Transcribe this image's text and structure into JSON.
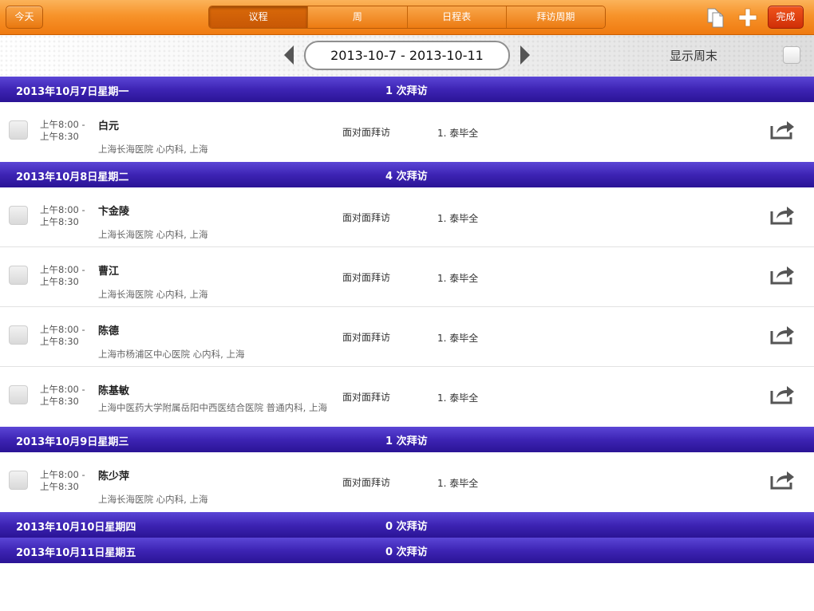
{
  "toolbar": {
    "today_label": "今天",
    "tabs": [
      {
        "label": "议程",
        "active": true
      },
      {
        "label": "周",
        "active": false
      },
      {
        "label": "日程表",
        "active": false
      },
      {
        "label": "拜访周期",
        "active": false
      }
    ],
    "copy_icon": "copy-icon",
    "add_icon": "plus-icon",
    "done_label": "完成"
  },
  "datebar": {
    "range": "2013-10-7 - 2013-10-11",
    "show_weekend_label": "显示周末",
    "show_weekend_checked": false
  },
  "days": [
    {
      "date": "2013年10月7日星期一",
      "count": "1 次拜访",
      "visits": [
        {
          "time1": "上午8:00 -",
          "time2": "上午8:30",
          "name": "白元",
          "address": "上海长海医院 心内科, 上海",
          "type": "面对面拜访",
          "person": "1. 泰毕全"
        }
      ]
    },
    {
      "date": "2013年10月8日星期二",
      "count": "4 次拜访",
      "visits": [
        {
          "time1": "上午8:00 -",
          "time2": "上午8:30",
          "name": "卞金陵",
          "address": "上海长海医院 心内科, 上海",
          "type": "面对面拜访",
          "person": "1. 泰毕全"
        },
        {
          "time1": "上午8:00 -",
          "time2": "上午8:30",
          "name": "曹江",
          "address": "上海长海医院 心内科, 上海",
          "type": "面对面拜访",
          "person": "1. 泰毕全"
        },
        {
          "time1": "上午8:00 -",
          "time2": "上午8:30",
          "name": "陈德",
          "address": "上海市杨浦区中心医院 心内科, 上海",
          "type": "面对面拜访",
          "person": "1. 泰毕全"
        },
        {
          "time1": "上午8:00 -",
          "time2": "上午8:30",
          "name": "陈基敏",
          "address": "上海中医药大学附属岳阳中西医结合医院 普通内科, 上海",
          "type": "面对面拜访",
          "person": "1. 泰毕全"
        }
      ]
    },
    {
      "date": "2013年10月9日星期三",
      "count": "1 次拜访",
      "visits": [
        {
          "time1": "上午8:00 -",
          "time2": "上午8:30",
          "name": "陈少萍",
          "address": "上海长海医院 心内科, 上海",
          "type": "面对面拜访",
          "person": "1. 泰毕全"
        }
      ]
    },
    {
      "date": "2013年10月10日星期四",
      "count": "0 次拜访",
      "visits": []
    },
    {
      "date": "2013年10月11日星期五",
      "count": "0 次拜访",
      "visits": []
    }
  ],
  "colors": {
    "toolbar_orange": "#f7932a",
    "done_red": "#d9380c",
    "day_header_purple": "#3d24b4"
  }
}
